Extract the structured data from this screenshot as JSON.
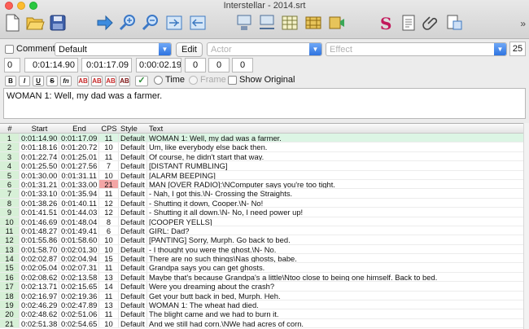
{
  "window": {
    "title": "Interstellar - 2014.srt"
  },
  "toolbar": {
    "icons": [
      "new-file-icon",
      "open-folder-icon",
      "save-disk-icon",
      "go-arrow-icon",
      "zoom-in-icon",
      "zoom-out-icon",
      "frame-icon",
      "timing-icon",
      "translate-icon",
      "waveform-icon",
      "grid-icon",
      "film-icon",
      "video-icon",
      "spellcheck-icon",
      "notes-icon",
      "attach-icon",
      "export-icon"
    ],
    "overflow": "»"
  },
  "editor": {
    "comment_label": "Comment",
    "style_value": "Default",
    "edit_button": "Edit",
    "actor_placeholder": "Actor",
    "effect_placeholder": "Effect",
    "layer_value": "25",
    "layer_index": "0",
    "start_time": "0:01:14.90",
    "end_time": "0:01:17.09",
    "duration": "0:00:02.19",
    "margin_left": "0",
    "margin_right": "0",
    "margin_vertical": "0",
    "format_buttons": [
      "B",
      "I",
      "U",
      "S",
      "fn",
      "AB",
      "AB",
      "AB",
      "AB"
    ],
    "commit_icon": "✓",
    "time_label": "Time",
    "frame_label": "Frame",
    "show_original_label": "Show Original",
    "text": "WOMAN 1: Well, my dad was a farmer."
  },
  "grid": {
    "headers": {
      "num": "#",
      "start": "Start",
      "end": "End",
      "cps": "CPS",
      "style": "Style",
      "text": "Text"
    },
    "rows": [
      {
        "num": "1",
        "start": "0:01:14.90",
        "end": "0:01:17.09",
        "cps": "11",
        "style": "Default",
        "text": "WOMAN 1: Well, my dad was a farmer."
      },
      {
        "num": "2",
        "start": "0:01:18.16",
        "end": "0:01:20.72",
        "cps": "10",
        "style": "Default",
        "text": "Um, like everybody else back then."
      },
      {
        "num": "3",
        "start": "0:01:22.74",
        "end": "0:01:25.01",
        "cps": "11",
        "style": "Default",
        "text": "Of course, he didn't start that way."
      },
      {
        "num": "4",
        "start": "0:01:25.50",
        "end": "0:01:27.56",
        "cps": "7",
        "style": "Default",
        "text": "[DISTANT RUMBLING]"
      },
      {
        "num": "5",
        "start": "0:01:30.00",
        "end": "0:01:31.11",
        "cps": "10",
        "style": "Default",
        "text": "[ALARM BEEPING]"
      },
      {
        "num": "6",
        "start": "0:01:31.21",
        "end": "0:01:33.00",
        "cps": "21",
        "style": "Default",
        "text": "MAN [OVER RADIO]:\\NComputer says you're too tight."
      },
      {
        "num": "7",
        "start": "0:01:33.10",
        "end": "0:01:35.94",
        "cps": "11",
        "style": "Default",
        "text": "- Nah, I got this.\\N- Crossing the Straights."
      },
      {
        "num": "8",
        "start": "0:01:38.26",
        "end": "0:01:40.11",
        "cps": "12",
        "style": "Default",
        "text": "- Shutting it down, Cooper.\\N- No!"
      },
      {
        "num": "9",
        "start": "0:01:41.51",
        "end": "0:01:44.03",
        "cps": "12",
        "style": "Default",
        "text": "- Shutting it all down.\\N- No, I need power up!"
      },
      {
        "num": "10",
        "start": "0:01:46.69",
        "end": "0:01:48.04",
        "cps": "8",
        "style": "Default",
        "text": "[COOPER YELLS]"
      },
      {
        "num": "11",
        "start": "0:01:48.27",
        "end": "0:01:49.41",
        "cps": "6",
        "style": "Default",
        "text": "GIRL: Dad?"
      },
      {
        "num": "12",
        "start": "0:01:55.86",
        "end": "0:01:58.60",
        "cps": "10",
        "style": "Default",
        "text": "[PANTING] Sorry, Murph. Go back to bed."
      },
      {
        "num": "13",
        "start": "0:01:58.70",
        "end": "0:02:01.30",
        "cps": "10",
        "style": "Default",
        "text": "- I thought you were the ghost.\\N- No."
      },
      {
        "num": "14",
        "start": "0:02:02.87",
        "end": "0:02:04.94",
        "cps": "15",
        "style": "Default",
        "text": "There are no such things\\Nas ghosts, babe."
      },
      {
        "num": "15",
        "start": "0:02:05.04",
        "end": "0:02:07.31",
        "cps": "11",
        "style": "Default",
        "text": "Grandpa says you can get ghosts."
      },
      {
        "num": "16",
        "start": "0:02:08.62",
        "end": "0:02:13.58",
        "cps": "13",
        "style": "Default",
        "text": "Maybe that's because Grandpa's a little\\Ntoo close to being one himself. Back to bed."
      },
      {
        "num": "17",
        "start": "0:02:13.71",
        "end": "0:02:15.65",
        "cps": "14",
        "style": "Default",
        "text": "Were you dreaming about the crash?"
      },
      {
        "num": "18",
        "start": "0:02:16.97",
        "end": "0:02:19.36",
        "cps": "11",
        "style": "Default",
        "text": "Get your butt back in bed, Murph. Heh."
      },
      {
        "num": "19",
        "start": "0:02:46.29",
        "end": "0:02:47.89",
        "cps": "13",
        "style": "Default",
        "text": "WOMAN 1: The wheat had died."
      },
      {
        "num": "20",
        "start": "0:02:48.62",
        "end": "0:02:51.06",
        "cps": "11",
        "style": "Default",
        "text": "The blight came and we had to burn it."
      },
      {
        "num": "21",
        "start": "0:02:51.38",
        "end": "0:02:54.65",
        "cps": "10",
        "style": "Default",
        "text": "And we still had corn.\\NWe had acres of corn."
      }
    ]
  },
  "colors": {
    "selected_row": "#dcf5e4",
    "row_number_bg": "#d7f0d7",
    "cps_warning": "#f3a5a5",
    "accent": "#2f74e0"
  }
}
